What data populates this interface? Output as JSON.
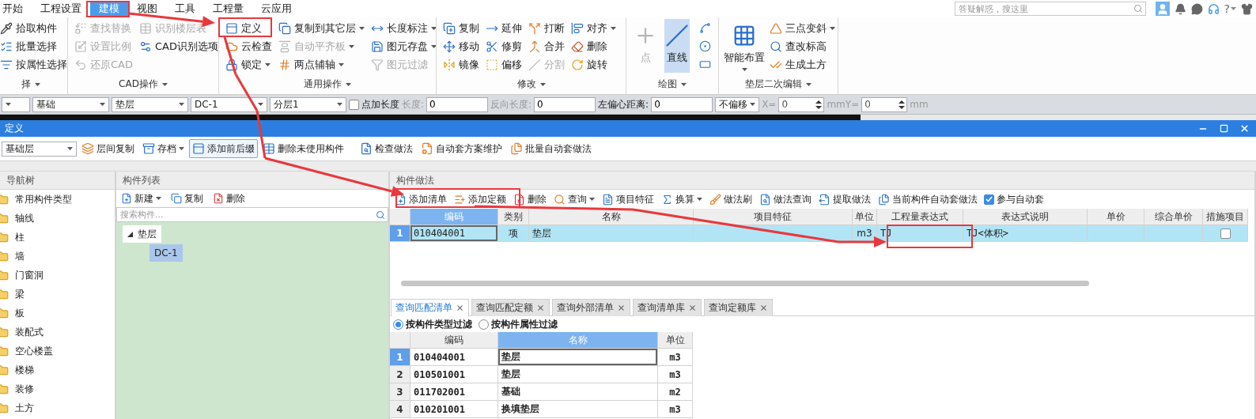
{
  "menu": {
    "tabs": [
      {
        "label": "开始",
        "selected": false
      },
      {
        "label": "工程设置",
        "selected": false
      },
      {
        "label": "建模",
        "selected": true
      },
      {
        "label": "视图",
        "selected": false
      },
      {
        "label": "工具",
        "selected": false
      },
      {
        "label": "工程量",
        "selected": false
      },
      {
        "label": "云应用",
        "selected": false
      }
    ],
    "search": {
      "placeholder": "答疑解惑，搜这里"
    },
    "help": "?"
  },
  "ribbon": {
    "groups": [
      {
        "label": "择",
        "items": [
          {
            "kind": "small",
            "label": "拾取构件",
            "disabled": false,
            "dropdown": false
          },
          {
            "kind": "small",
            "label": "批量选择",
            "disabled": false,
            "dropdown": false
          },
          {
            "kind": "small",
            "label": "按属性选择",
            "disabled": false,
            "dropdown": false
          }
        ]
      },
      {
        "label": "CAD操作",
        "items": [
          {
            "kind": "small",
            "label": "查找替换",
            "disabled": true,
            "dropdown": false
          },
          {
            "kind": "small",
            "label": "设置比例",
            "disabled": true,
            "dropdown": false
          },
          {
            "kind": "small",
            "label": "还原CAD",
            "disabled": true,
            "dropdown": false
          },
          {
            "kind": "small",
            "label": "识别楼层表",
            "disabled": true,
            "dropdown": false
          },
          {
            "kind": "small",
            "label": "CAD识别选项",
            "disabled": false,
            "dropdown": false
          }
        ]
      },
      {
        "label": "通用操作",
        "items": [
          {
            "kind": "small",
            "label": "定义",
            "disabled": false,
            "dropdown": false
          },
          {
            "kind": "small",
            "label": "云检查",
            "disabled": false,
            "dropdown": false
          },
          {
            "kind": "small",
            "label": "锁定",
            "disabled": false,
            "dropdown": true
          },
          {
            "kind": "small",
            "label": "复制到其它层",
            "disabled": false,
            "dropdown": true
          },
          {
            "kind": "small",
            "label": "自动平齐板",
            "disabled": true,
            "dropdown": true
          },
          {
            "kind": "small",
            "label": "两点辅轴",
            "disabled": false,
            "dropdown": true
          },
          {
            "kind": "small",
            "label": "长度标注",
            "disabled": false,
            "dropdown": true
          },
          {
            "kind": "small",
            "label": "图元存盘",
            "disabled": false,
            "dropdown": true
          },
          {
            "kind": "small",
            "label": "图元过滤",
            "disabled": true,
            "dropdown": false
          }
        ]
      },
      {
        "label": "修改",
        "items": [
          {
            "kind": "small",
            "label": "复制",
            "disabled": false,
            "dropdown": false
          },
          {
            "kind": "small",
            "label": "移动",
            "disabled": false,
            "dropdown": false
          },
          {
            "kind": "small",
            "label": "镜像",
            "disabled": false,
            "dropdown": false
          },
          {
            "kind": "small",
            "label": "延伸",
            "disabled": false,
            "dropdown": false
          },
          {
            "kind": "small",
            "label": "修剪",
            "disabled": false,
            "dropdown": false
          },
          {
            "kind": "small",
            "label": "偏移",
            "disabled": false,
            "dropdown": false
          },
          {
            "kind": "small",
            "label": "打断",
            "disabled": false,
            "dropdown": false
          },
          {
            "kind": "small",
            "label": "合并",
            "disabled": false,
            "dropdown": false
          },
          {
            "kind": "small",
            "label": "分割",
            "disabled": true,
            "dropdown": false
          },
          {
            "kind": "small",
            "label": "对齐",
            "disabled": false,
            "dropdown": true
          },
          {
            "kind": "small",
            "label": "删除",
            "disabled": false,
            "dropdown": false
          },
          {
            "kind": "small",
            "label": "旋转",
            "disabled": false,
            "dropdown": false
          }
        ]
      },
      {
        "label": "绘图",
        "items": [
          {
            "kind": "big",
            "label": "点",
            "disabled": true,
            "dropdown": false,
            "selected": false
          },
          {
            "kind": "big",
            "label": "直线",
            "disabled": false,
            "dropdown": false,
            "selected": true
          },
          {
            "kind": "icon",
            "disabled": false,
            "dropdown": false,
            "selected": false
          },
          {
            "kind": "icon",
            "disabled": false,
            "dropdown": false,
            "selected": false
          },
          {
            "kind": "icon",
            "disabled": false,
            "dropdown": false,
            "selected": false
          }
        ]
      },
      {
        "label": "垫层二次编辑",
        "items": [
          {
            "kind": "big",
            "label": "智能布置",
            "disabled": false,
            "dropdown": true
          },
          {
            "kind": "small",
            "label": "三点变斜",
            "disabled": false,
            "dropdown": true
          },
          {
            "kind": "small",
            "label": "查改标高",
            "disabled": false,
            "dropdown": false
          },
          {
            "kind": "small",
            "label": "生成土方",
            "disabled": false,
            "dropdown": false
          }
        ]
      }
    ]
  },
  "property_bar": [
    {
      "kind": "combo",
      "disabled": false
    },
    {
      "kind": "combo",
      "value": "基础",
      "disabled": false
    },
    {
      "kind": "combo",
      "value": "垫层",
      "disabled": false
    },
    {
      "kind": "combo",
      "value": "DC-1",
      "disabled": false
    },
    {
      "kind": "combo",
      "value": "分层1",
      "disabled": false
    },
    {
      "kind": "checkbox",
      "label": "点加长度",
      "checked": false,
      "disabled": false
    },
    {
      "kind": "field",
      "label": "长度:",
      "value": "0",
      "disabled": true
    },
    {
      "kind": "field",
      "label": "反向长度:",
      "value": "0",
      "disabled": true
    },
    {
      "kind": "field",
      "label": "左偏心距离:",
      "value": "0",
      "disabled": false
    },
    {
      "kind": "combo",
      "value": "不偏移",
      "disabled": false
    },
    {
      "kind": "spinner",
      "label": "X=",
      "value": "0",
      "disabled": true
    },
    {
      "kind": "spinner",
      "label": "mmY=",
      "value": "0",
      "disabled": true
    },
    {
      "kind": "unit",
      "label": "mm",
      "disabled": true
    }
  ],
  "dialog": {
    "title": "定义",
    "toolbar": {
      "floor": "基础层",
      "buttons": [
        {
          "label": "层间复制",
          "dropdown": false,
          "selected": false
        },
        {
          "label": "存档",
          "dropdown": true,
          "selected": false
        },
        {
          "label": "添加前后缀",
          "dropdown": false,
          "selected": true
        },
        {
          "label": "删除未使用构件",
          "dropdown": false,
          "selected": false
        },
        {
          "label": "检查做法",
          "dropdown": false,
          "selected": false
        },
        {
          "label": "自动套方案维护",
          "dropdown": false,
          "selected": false
        },
        {
          "label": "批量自动套做法",
          "dropdown": false,
          "selected": false
        }
      ]
    },
    "nav_tree": {
      "title": "导航树",
      "items": [
        {
          "label": "常用构件类型",
          "selected": false
        },
        {
          "label": "轴线",
          "selected": false
        },
        {
          "label": "柱",
          "selected": false
        },
        {
          "label": "墙",
          "selected": false
        },
        {
          "label": "门窗洞",
          "selected": false
        },
        {
          "label": "梁",
          "selected": false
        },
        {
          "label": "板",
          "selected": false
        },
        {
          "label": "装配式",
          "selected": false
        },
        {
          "label": "空心楼盖",
          "selected": false
        },
        {
          "label": "楼梯",
          "selected": false
        },
        {
          "label": "装修",
          "selected": false
        },
        {
          "label": "土方",
          "selected": false
        }
      ]
    },
    "component_list": {
      "title": "构件列表",
      "toolbar": [
        {
          "label": "新建",
          "dropdown": true
        },
        {
          "label": "复制",
          "dropdown": false
        },
        {
          "label": "删除",
          "dropdown": false
        }
      ],
      "search": {
        "placeholder": "搜索构件..."
      },
      "tree": [
        {
          "label": "垫层",
          "expanded": true,
          "selected": false,
          "children": [
            {
              "label": "DC-1",
              "selected": true
            }
          ]
        }
      ]
    },
    "method_panel": {
      "title": "构件做法",
      "toolbar": [
        {
          "kind": "button",
          "label": "添加清单",
          "dropdown": false
        },
        {
          "kind": "button",
          "label": "添加定额",
          "dropdown": false
        },
        {
          "kind": "button",
          "label": "删除",
          "dropdown": false
        },
        {
          "kind": "button",
          "label": "查询",
          "dropdown": true
        },
        {
          "kind": "button",
          "label": "项目特征",
          "dropdown": false
        },
        {
          "kind": "button",
          "label": "换算",
          "dropdown": true
        },
        {
          "kind": "button",
          "label": "做法刷",
          "dropdown": false
        },
        {
          "kind": "button",
          "label": "做法查询",
          "dropdown": false
        },
        {
          "kind": "button",
          "label": "提取做法",
          "dropdown": false
        },
        {
          "kind": "button",
          "label": "当前构件自动套做法",
          "dropdown": false
        },
        {
          "kind": "checkbox",
          "label": "参与自动套",
          "checked": true
        }
      ],
      "table": {
        "columns": [
          {
            "label": "编码",
            "selected": true
          },
          {
            "label": "类别",
            "selected": false
          },
          {
            "label": "名称",
            "selected": false
          },
          {
            "label": "项目特征",
            "selected": false
          },
          {
            "label": "单位",
            "selected": false
          },
          {
            "label": "工程量表达式",
            "selected": false
          },
          {
            "label": "表达式说明",
            "selected": false
          },
          {
            "label": "单价",
            "selected": false
          },
          {
            "label": "综合单价",
            "selected": false
          },
          {
            "label": "措施项目",
            "selected": false
          }
        ],
        "rows": [
          {
            "number": "1",
            "selected": true,
            "code": "010404001",
            "category": "项",
            "name": "垫层",
            "unit": "m3",
            "expression": "TJ",
            "expression_note": "TJ<体积>",
            "measure_item": false
          }
        ]
      },
      "query_tabs": [
        {
          "label": "查询匹配清单",
          "selected": true
        },
        {
          "label": "查询匹配定额",
          "selected": false
        },
        {
          "label": "查询外部清单",
          "selected": false
        },
        {
          "label": "查询清单库",
          "selected": false
        },
        {
          "label": "查询定额库",
          "selected": false
        }
      ],
      "filters": [
        {
          "label": "按构件类型过滤",
          "selected": true
        },
        {
          "label": "按构件属性过滤",
          "selected": false
        }
      ],
      "query_table": {
        "columns": [
          {
            "label": "编码",
            "selected": false
          },
          {
            "label": "名称",
            "selected": true
          },
          {
            "label": "单位",
            "selected": false
          }
        ],
        "rows": [
          {
            "number": "1",
            "selected": true,
            "code": "010404001",
            "name": "垫层",
            "unit": "m3"
          },
          {
            "number": "2",
            "selected": false,
            "code": "010501001",
            "name": "垫层",
            "unit": "m3"
          },
          {
            "number": "3",
            "selected": false,
            "code": "011702001",
            "name": "基础",
            "unit": "m2"
          },
          {
            "number": "4",
            "selected": false,
            "code": "010201001",
            "name": "换填垫层",
            "unit": "m3"
          }
        ]
      }
    }
  }
}
